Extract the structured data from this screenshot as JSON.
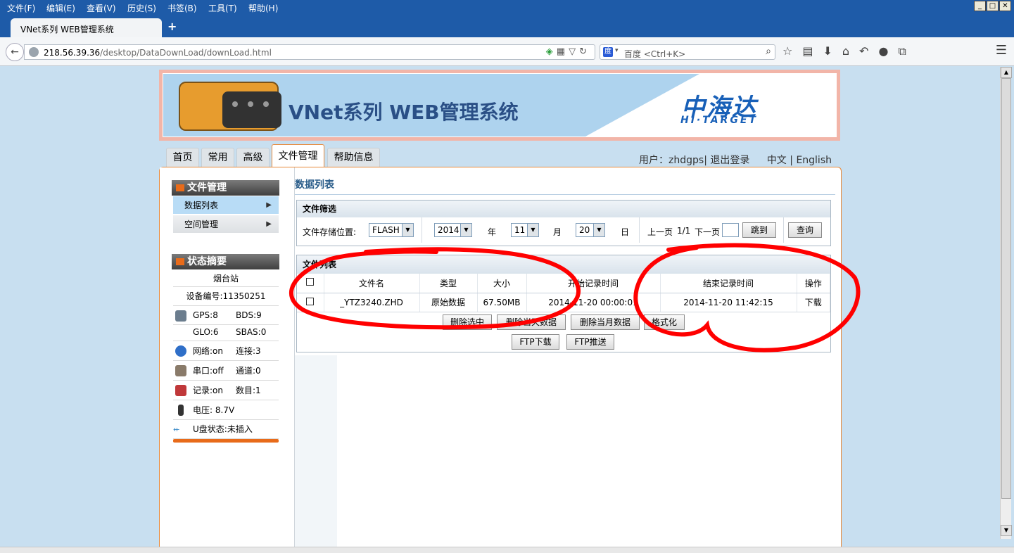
{
  "browser": {
    "menu": [
      "文件(F)",
      "编辑(E)",
      "查看(V)",
      "历史(S)",
      "书签(B)",
      "工具(T)",
      "帮助(H)"
    ],
    "tab_title": "VNet系列 WEB管理系统",
    "new_tab": "+",
    "url_host": "218.56.39.36",
    "url_path": "/desktop/DataDownLoad/downLoad.html",
    "search_placeholder": "百度 <Ctrl+K>"
  },
  "banner": {
    "title": "VNet系列 WEB管理系统",
    "brand_cn": "中海达",
    "brand_en": "HI·TARGET"
  },
  "nav": {
    "tabs": [
      "首页",
      "常用",
      "高级",
      "文件管理",
      "帮助信息"
    ],
    "active": "文件管理",
    "user_label": "用户：",
    "user_name": "zhdgps",
    "sep": "|",
    "logout": "退出登录",
    "lang_cn": "中文",
    "lang_sep": "|",
    "lang_en": "English"
  },
  "sidebar": {
    "file_header": "文件管理",
    "file_items": [
      "数据列表",
      "空间管理"
    ],
    "status_header": "状态摘要",
    "station": "烟台站",
    "device_label": "设备编号:",
    "device_id": "11350251",
    "rows": [
      {
        "a": "GPS:8",
        "b": "BDS:9",
        "icon": "satellite-icon",
        "color": "#6b7d8e"
      },
      {
        "a": "GLO:6",
        "b": "SBAS:0",
        "icon": "",
        "color": ""
      },
      {
        "a": "网络:on",
        "b": "连接:3",
        "icon": "globe-icon",
        "color": "#2f6fc8"
      },
      {
        "a": "串口:off",
        "b": "通道:0",
        "icon": "serial-icon",
        "color": "#8a7b6a"
      },
      {
        "a": "记录:on",
        "b": "数目:1",
        "icon": "record-icon",
        "color": "#c0383a"
      },
      {
        "a": "电压: 8.7V",
        "b": "",
        "icon": "battery-icon",
        "color": "#333333"
      },
      {
        "a": "U盘状态:未插入",
        "b": "",
        "icon": "usb-icon",
        "color": "#3a8ac8"
      }
    ]
  },
  "list": {
    "title": "数据列表",
    "filter_header": "文件筛选",
    "location_label": "文件存储位置:",
    "location_value": "FLASH",
    "year_value": "2014",
    "year_label": "年",
    "month_value": "11",
    "month_label": "月",
    "day_value": "20",
    "day_label": "日",
    "prev_page": "上一页",
    "page_info": "1/1",
    "next_page": "下一页",
    "jump_button": "跳到",
    "query_button": "查询",
    "filelist_header": "文件列表",
    "columns": [
      "文件名",
      "类型",
      "大小",
      "开始记录时间",
      "结束记录时间",
      "操作"
    ],
    "rows": [
      {
        "name": "_YTZ3240.ZHD",
        "type": "原始数据",
        "size": "67.50MB",
        "start": "2014-11-20 00:00:01",
        "end": "2014-11-20 11:42:15",
        "op": "下载"
      }
    ],
    "actions": [
      "删除选中",
      "删除当天数据",
      "删除当月数据",
      "格式化"
    ],
    "ftp_download": "FTP下载",
    "ftp_push": "FTP推送"
  },
  "colors": {
    "accent": "#e8893a",
    "annotation": "#ff0000",
    "chrome": "#1e5ba8"
  }
}
